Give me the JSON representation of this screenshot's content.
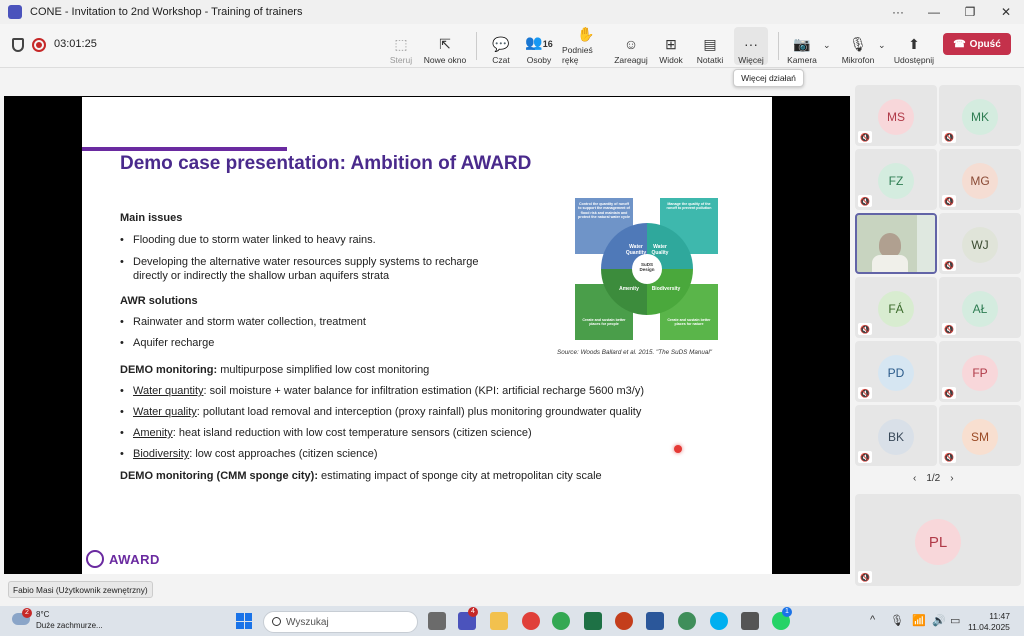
{
  "window": {
    "title": "CONE - Invitation to 2nd Workshop - Training of trainers",
    "more_glyph": "···",
    "minimize_glyph": "—",
    "maximize_glyph": "❐",
    "close_glyph": "✕"
  },
  "toolbar": {
    "timer": "03:01:25",
    "buttons": [
      {
        "label": "Steruj",
        "icon": "steer-icon",
        "glyph": "⬚"
      },
      {
        "label": "Nowe okno",
        "icon": "new-window-icon",
        "glyph": "⇱"
      },
      {
        "label": "Czat",
        "icon": "chat-icon",
        "glyph": "💬"
      },
      {
        "label": "Osoby",
        "icon": "people-icon",
        "glyph": "👥",
        "count": "16"
      },
      {
        "label": "Podnieś rękę",
        "icon": "raise-hand-icon",
        "glyph": "✋"
      },
      {
        "label": "Zareaguj",
        "icon": "react-icon",
        "glyph": "☺"
      },
      {
        "label": "Widok",
        "icon": "view-icon",
        "glyph": "⊞"
      },
      {
        "label": "Notatki",
        "icon": "notes-icon",
        "glyph": "▤"
      },
      {
        "label": "Więcej",
        "icon": "more-icon",
        "glyph": "···"
      },
      {
        "label": "Kamera",
        "icon": "camera-icon",
        "glyph": "📷"
      },
      {
        "label": "Mikrofon",
        "icon": "microphone-icon",
        "glyph": "🎙"
      },
      {
        "label": "Udostępnij",
        "icon": "share-icon",
        "glyph": "⬆"
      }
    ],
    "leave_label": "Opuść",
    "more_tooltip": "Więcej działań"
  },
  "slide": {
    "title": "Demo case presentation: Ambition of AWARD",
    "main_issues_heading": "Main issues",
    "main_issues": [
      "Flooding due to storm water linked to heavy rains.",
      "Developing the alternative water resources supply systems to recharge directly or indirectly the shallow urban aquifers strata"
    ],
    "awr_heading": "AWR solutions",
    "awr_items": [
      "Rainwater and storm water collection, treatment",
      "Aquifer recharge"
    ],
    "demo_heading": "DEMO monitoring:",
    "demo_text": " multipurpose simplified low cost monitoring",
    "demo_items": [
      {
        "term": "Water quantity",
        "text": ": soil moisture + water balance for infiltration estimation (KPI: artificial recharge 5600 m3/y)"
      },
      {
        "term": "Water quality",
        "text": ": pollutant load removal and interception (proxy rainfall) plus monitoring groundwater quality"
      },
      {
        "term": "Amenity",
        "text": ": heat island reduction with low cost temperature sensors (citizen science)"
      },
      {
        "term": "Biodiversity",
        "text": ": low cost approaches (citizen science)"
      }
    ],
    "cmm_heading": "DEMO monitoring (CMM sponge city):",
    "cmm_text": "  estimating impact of sponge city at metropolitan city scale",
    "diagram": {
      "center": "SuDS Design",
      "segments": [
        "Water Quantity",
        "Water Quality",
        "Amenity",
        "Biodiversity"
      ],
      "notes": [
        "Control the quantity of runoff to support the management of flood risk and maintain and protect the natural water cycle",
        "Manage the quality of the runoff to prevent pollution",
        "Create and sustain better places for people",
        "Create and sustain better places for nature"
      ]
    },
    "source": "Source:  Woods Ballard et al. 2015. \"The SuDS Manual\"",
    "logo_text": "AWARD"
  },
  "participants": [
    {
      "initials": "MS",
      "bg": "#f8d7da",
      "fg": "#b03a48"
    },
    {
      "initials": "MK",
      "bg": "#d4ecdf",
      "fg": "#2e7d52"
    },
    {
      "initials": "FZ",
      "bg": "#d4ecdf",
      "fg": "#2e7d52"
    },
    {
      "initials": "MG",
      "bg": "#f5ddd3",
      "fg": "#8a4a35"
    },
    {
      "initials": "video",
      "bg": "#c8d4c0",
      "fg": "#333"
    },
    {
      "initials": "WJ",
      "bg": "#e0e4d9",
      "fg": "#3a4a30"
    },
    {
      "initials": "FÁ",
      "bg": "#d8ecd0",
      "fg": "#3a6a2a"
    },
    {
      "initials": "AŁ",
      "bg": "#d4ecdf",
      "fg": "#2e7d52"
    },
    {
      "initials": "PD",
      "bg": "#d6e6f2",
      "fg": "#2a5a8a"
    },
    {
      "initials": "FP",
      "bg": "#f8d7da",
      "fg": "#b03a48"
    },
    {
      "initials": "BK",
      "bg": "#d9e0e8",
      "fg": "#3a4a5a"
    },
    {
      "initials": "SM",
      "bg": "#f8dfd0",
      "fg": "#9a4a25"
    }
  ],
  "pager": "1/2",
  "big_participant": {
    "initials": "PL"
  },
  "presenter_name": "Fabio Masi (Użytkownik zewnętrzny)",
  "taskbar": {
    "weather_temp": "8°C",
    "weather_desc": "Duże zachmurze...",
    "weather_badge": "2",
    "search_placeholder": "Wyszukaj",
    "time": "11:47",
    "date": "11.04.2025",
    "app_badge": "4",
    "whatsapp_badge": "1"
  }
}
